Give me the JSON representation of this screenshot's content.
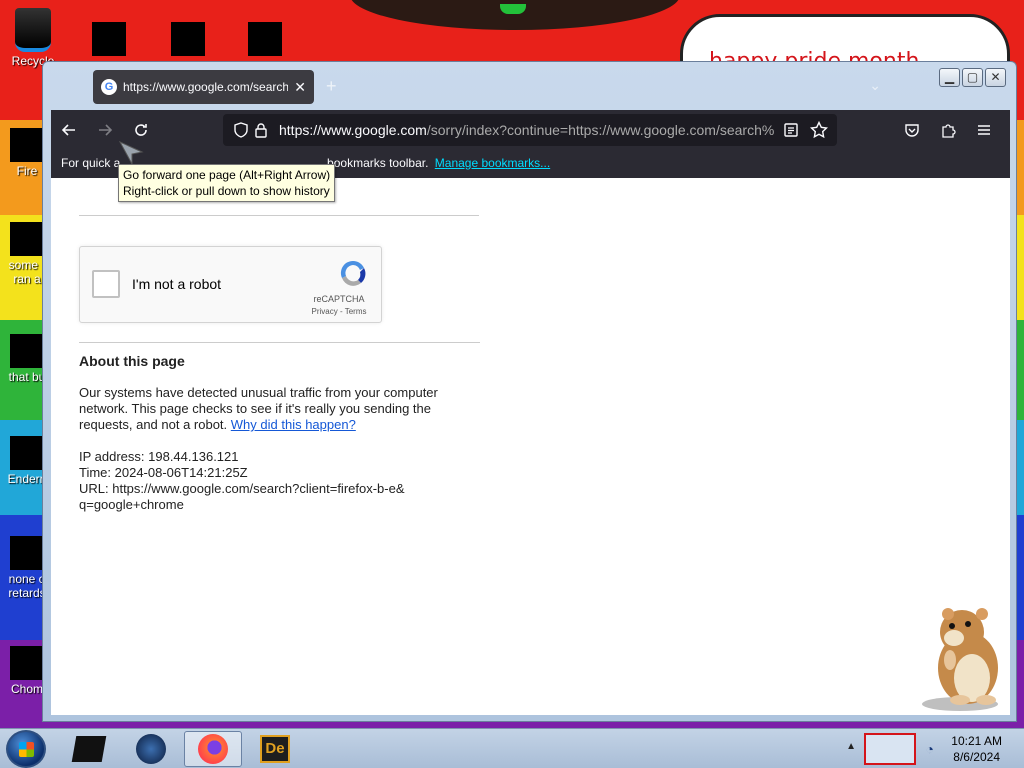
{
  "desktop": {
    "bubble_text": "happy pride month",
    "icons": [
      {
        "label": "Recycle"
      },
      {
        "label": "Fire"
      },
      {
        "label": "some r"
      },
      {
        "label": "ran a"
      },
      {
        "label": "that bu"
      },
      {
        "label": "Endern"
      },
      {
        "label": "none o"
      },
      {
        "label": "retards"
      },
      {
        "label": "Chom"
      }
    ]
  },
  "browser": {
    "tab_title": "https://www.google.com/search",
    "url_domain": "https://www.google.com",
    "url_path": "/sorry/index?continue=https://www.google.com/search%",
    "bookmarks_prefix": "For quick a",
    "bookmarks_suffix": "bookmarks toolbar.",
    "manage_bookmarks": "Manage bookmarks...",
    "tooltip_line1": "Go forward one page (Alt+Right Arrow)",
    "tooltip_line2": "Right-click or pull down to show history"
  },
  "page": {
    "captcha_label": "I'm not a robot",
    "captcha_brand": "reCAPTCHA",
    "captcha_terms": "Privacy - Terms",
    "about_title": "About this page",
    "about_body": "Our systems have detected unusual traffic from your computer network. This page checks to see if it's really you sending the requests, and not a robot.",
    "why_link": "Why did this happen?",
    "ip_line": "IP address: 198.44.136.121",
    "time_line": "Time: 2024-08-06T14:21:25Z",
    "url_line1": "URL: https://www.google.com/search?client=firefox-b-e&",
    "url_line2": "q=google+chrome"
  },
  "taskbar": {
    "time": "10:21 AM",
    "date": "8/6/2024"
  },
  "colors": {
    "firefox_toolbar": "#2b2a33",
    "link": "#1558d6",
    "bookmarks_link": "#00ddff"
  }
}
